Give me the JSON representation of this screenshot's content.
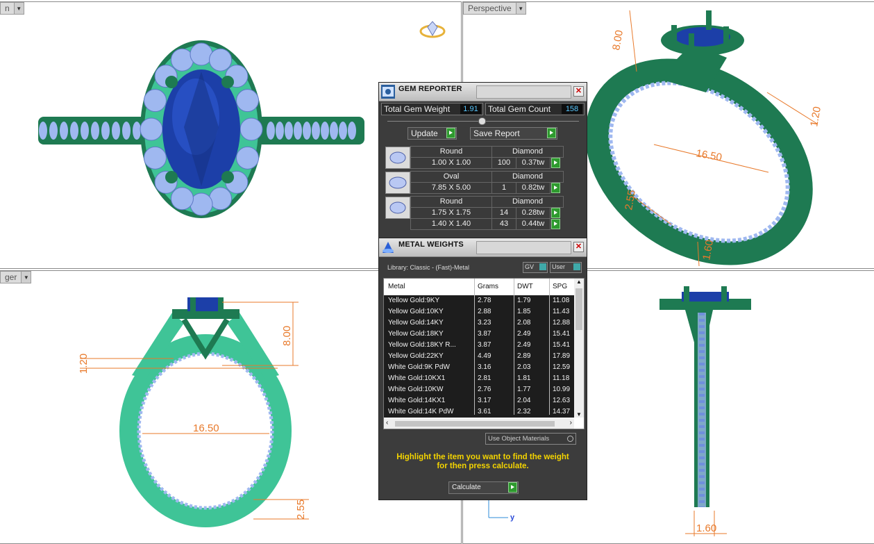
{
  "viewports": {
    "top_left": {
      "label": "n"
    },
    "top_right": {
      "label": "Perspective"
    },
    "bottom_left": {
      "label": "ger"
    },
    "bottom_right": {
      "label": ""
    }
  },
  "dimensions": {
    "persp_height": "8.00",
    "persp_shank": "1.20",
    "persp_diam": "16.50",
    "persp_band": "2.55",
    "persp_width": "1.60",
    "front_height": "8.00",
    "front_shank": "1.20",
    "front_diam": "16.50",
    "front_band": "2.55",
    "side_width": "1.60",
    "axis_y": "y"
  },
  "gem_reporter": {
    "title": "GEM REPORTER",
    "total_weight_label": "Total Gem Weight",
    "total_weight": "1.91",
    "total_count_label": "Total Gem Count",
    "total_count": "158",
    "update_label": "Update",
    "save_label": "Save Report",
    "groups": [
      {
        "shape": "Round",
        "material": "Diamond",
        "rows": [
          {
            "size": "1.00 X 1.00",
            "count": "100",
            "weight": "0.37tw"
          }
        ]
      },
      {
        "shape": "Oval",
        "material": "Diamond",
        "rows": [
          {
            "size": "7.85 X 5.00",
            "count": "1",
            "weight": "0.82tw"
          }
        ]
      },
      {
        "shape": "Round",
        "material": "Diamond",
        "rows": [
          {
            "size": "1.75 X 1.75",
            "count": "14",
            "weight": "0.28tw"
          },
          {
            "size": "1.40 X 1.40",
            "count": "43",
            "weight": "0.44tw"
          }
        ]
      }
    ]
  },
  "metal_weights": {
    "title": "METAL WEIGHTS",
    "library": "Library: Classic - (Fast)-Metal",
    "gv_label": "GV",
    "user_label": "User",
    "columns": [
      "Metal",
      "Grams",
      "DWT",
      "SPG"
    ],
    "rows": [
      [
        "Yellow Gold:9KY",
        "2.78",
        "1.79",
        "11.08"
      ],
      [
        "Yellow Gold:10KY",
        "2.88",
        "1.85",
        "11.43"
      ],
      [
        "Yellow Gold:14KY",
        "3.23",
        "2.08",
        "12.88"
      ],
      [
        "Yellow Gold:18KY",
        "3.87",
        "2.49",
        "15.41"
      ],
      [
        "Yellow Gold:18KY R...",
        "3.87",
        "2.49",
        "15.41"
      ],
      [
        "Yellow Gold:22KY",
        "4.49",
        "2.89",
        "17.89"
      ],
      [
        "White Gold:9K PdW",
        "3.16",
        "2.03",
        "12.59"
      ],
      [
        "White Gold:10KX1",
        "2.81",
        "1.81",
        "11.18"
      ],
      [
        "White Gold:10KW",
        "2.76",
        "1.77",
        "10.99"
      ],
      [
        "White Gold:14KX1",
        "3.17",
        "2.04",
        "12.63"
      ],
      [
        "White Gold:14K PdW",
        "3.61",
        "2.32",
        "14.37"
      ]
    ],
    "use_object_materials": "Use Object Materials",
    "hint_line1": "Highlight the item you want to find the weight",
    "hint_line2": "for then press calculate.",
    "calculate_label": "Calculate"
  },
  "colors": {
    "metal": "#1e7a52",
    "metal_light": "#3fc497",
    "sapphire": "#1c3fa8",
    "diamond": "#9fb8f0",
    "dim": "#e8792a"
  }
}
